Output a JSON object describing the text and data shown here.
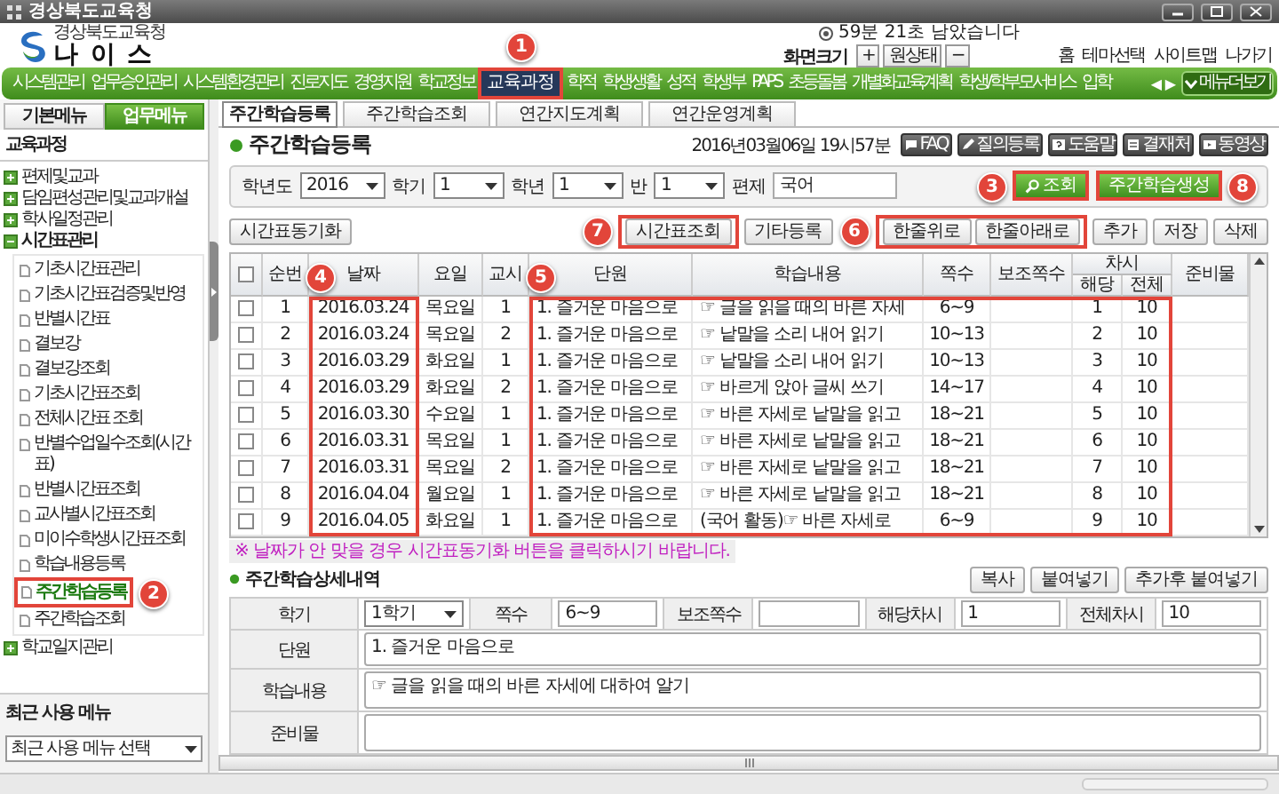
{
  "window": {
    "title": "경상북도교육청"
  },
  "header": {
    "org": "경상북도교육청",
    "logo": "나 이 스",
    "session": "59분 21초 남았습니다",
    "zoom_label": "화면크기",
    "zoom_buttons": [
      "+",
      "원상태",
      "−"
    ],
    "links": [
      "홈",
      "테마선택",
      "사이트맵",
      "나가기"
    ]
  },
  "nav": {
    "items": [
      {
        "label": "시스템관리",
        "selected": false,
        "framed": false
      },
      {
        "label": "업무승인관리",
        "selected": false,
        "framed": false
      },
      {
        "label": "시스템환경관리",
        "selected": false,
        "framed": false
      },
      {
        "label": "진로지도",
        "selected": false,
        "framed": false
      },
      {
        "label": "경영지원",
        "selected": false,
        "framed": false
      },
      {
        "label": "학교정보",
        "selected": false,
        "framed": false
      },
      {
        "label": "교육과정",
        "selected": true,
        "framed": true,
        "callout": "1"
      },
      {
        "label": "학적",
        "selected": false,
        "framed": false
      },
      {
        "label": "학생생활",
        "selected": false,
        "framed": false
      },
      {
        "label": "성적",
        "selected": false,
        "framed": false
      },
      {
        "label": "학생부",
        "selected": false,
        "framed": false
      },
      {
        "label": "PAPS",
        "selected": false,
        "framed": false
      },
      {
        "label": "초등돌봄",
        "selected": false,
        "framed": false
      },
      {
        "label": "개별화교육계획",
        "selected": false,
        "framed": false
      },
      {
        "label": "학생/학부모서비스",
        "selected": false,
        "framed": false
      },
      {
        "label": "입학",
        "selected": false,
        "framed": false
      }
    ],
    "prev": "◀",
    "next": "▶",
    "more": "메뉴더보기"
  },
  "sidebar": {
    "tabs": [
      {
        "label": "기본메뉴",
        "selected": false
      },
      {
        "label": "업무메뉴",
        "selected": true
      }
    ],
    "heading": "교육과정",
    "items": [
      {
        "label": "편제및교과",
        "expanded": false
      },
      {
        "label": "담임편성관리및교과개설",
        "expanded": false
      },
      {
        "label": "학사일정관리",
        "expanded": false
      },
      {
        "label": "시간표관리",
        "expanded": true,
        "children": [
          {
            "label": "기초시간표관리",
            "selected": false,
            "framed": false
          },
          {
            "label": "기초시간표검증및반영",
            "selected": false,
            "framed": false
          },
          {
            "label": "반별시간표",
            "selected": false,
            "framed": false
          },
          {
            "label": "결보강",
            "selected": false,
            "framed": false
          },
          {
            "label": "결보강조회",
            "selected": false,
            "framed": false
          },
          {
            "label": "기초시간표조회",
            "selected": false,
            "framed": false
          },
          {
            "label": "전체시간표 조회",
            "selected": false,
            "framed": false
          },
          {
            "label": "반별수업일수조회(시간표)",
            "selected": false,
            "framed": false
          },
          {
            "label": "반별시간표조회",
            "selected": false,
            "framed": false
          },
          {
            "label": "교사별시간표조회",
            "selected": false,
            "framed": false
          },
          {
            "label": "미이수학생시간표조회",
            "selected": false,
            "framed": false
          },
          {
            "label": "학습내용등록",
            "selected": false,
            "framed": false
          },
          {
            "label": "주간학습등록",
            "selected": true,
            "framed": true,
            "callout": "2"
          },
          {
            "label": "주간학습조회",
            "selected": false,
            "framed": false
          }
        ]
      },
      {
        "label": "학교일지관리",
        "expanded": false
      }
    ],
    "recent": {
      "title": "최근 사용 메뉴",
      "select": "최근 사용 메뉴 선택"
    }
  },
  "tabs": [
    {
      "label": "주간학습등록",
      "selected": true
    },
    {
      "label": "주간학습조회",
      "selected": false
    },
    {
      "label": "연간지도계획",
      "selected": false
    },
    {
      "label": "연간운영계획",
      "selected": false
    }
  ],
  "page": {
    "title": "주간학습등록",
    "datetime": "2016년03월06일 19시57분",
    "tools": [
      {
        "kind": "faq",
        "label": "FAQ"
      },
      {
        "kind": "write",
        "label": "질의등록"
      },
      {
        "kind": "help",
        "label": "도움말"
      },
      {
        "kind": "doc",
        "label": "결재처"
      },
      {
        "kind": "video",
        "label": "동영상"
      }
    ]
  },
  "filters": [
    {
      "label": "학년도",
      "kind": "select",
      "value": "2016"
    },
    {
      "label": "학기",
      "kind": "select",
      "value": "1"
    },
    {
      "label": "학년",
      "kind": "select",
      "value": "1"
    },
    {
      "label": "반",
      "kind": "select",
      "value": "1"
    },
    {
      "label": "편제",
      "kind": "text",
      "value": "국어"
    }
  ],
  "filter_buttons": [
    {
      "label": "조회",
      "kind": "search",
      "framed": true,
      "callout": "3"
    },
    {
      "label": "주간학습생성",
      "kind": "plain",
      "framed": true,
      "callout": "8"
    }
  ],
  "toolbar": {
    "left": [
      {
        "label": "시간표동기화",
        "framed": false
      }
    ],
    "right": [
      {
        "label": "시간표조회",
        "framed": true,
        "callout": "7"
      },
      {
        "label": "기타등록",
        "framed": false
      },
      {
        "label": "한줄위로",
        "framed": true,
        "callout": "6"
      },
      {
        "label": "한줄아래로",
        "framed": true
      },
      {
        "label": "추가",
        "framed": false
      },
      {
        "label": "저장",
        "framed": false
      },
      {
        "label": "삭제",
        "framed": false
      }
    ]
  },
  "table": {
    "columns": [
      {
        "kind": "check",
        "checked": false,
        "framed": false
      },
      {
        "label": "순번",
        "framed": false
      },
      {
        "label": "날짜",
        "framed": true,
        "callout": "4"
      },
      {
        "label": "요일",
        "framed": false
      },
      {
        "label": "교시",
        "framed": false
      },
      {
        "label": "단원",
        "framed": true,
        "callout": "5"
      },
      {
        "label": "학습내용",
        "framed": true
      },
      {
        "label": "쪽수",
        "framed": true
      },
      {
        "label": "보조쪽수",
        "framed": true
      },
      {
        "label": "차시",
        "framed": true,
        "subcolumns": [
          "해당",
          "전체"
        ]
      },
      {
        "label": "준비물",
        "framed": false
      }
    ],
    "rows": [
      {
        "checked": false,
        "no": "1",
        "date": "2016.03.24",
        "day": "목요일",
        "period": "1",
        "unit": "1. 즐거운 마음으로",
        "content": "☞ 글을 읽을 때의 바른 자세",
        "pages": "6~9",
        "part": "1",
        "total": "10"
      },
      {
        "checked": false,
        "no": "2",
        "date": "2016.03.24",
        "day": "목요일",
        "period": "2",
        "unit": "1. 즐거운 마음으로",
        "content": "☞ 낱말을 소리 내어 읽기",
        "pages": "10~13",
        "part": "2",
        "total": "10"
      },
      {
        "checked": false,
        "no": "3",
        "date": "2016.03.29",
        "day": "화요일",
        "period": "1",
        "unit": "1. 즐거운 마음으로",
        "content": "☞ 낱말을 소리 내어 읽기",
        "pages": "10~13",
        "part": "3",
        "total": "10"
      },
      {
        "checked": false,
        "no": "4",
        "date": "2016.03.29",
        "day": "화요일",
        "period": "2",
        "unit": "1. 즐거운 마음으로",
        "content": "☞ 바르게 앉아 글씨 쓰기",
        "pages": "14~17",
        "part": "4",
        "total": "10"
      },
      {
        "checked": false,
        "no": "5",
        "date": "2016.03.30",
        "day": "수요일",
        "period": "1",
        "unit": "1. 즐거운 마음으로",
        "content": "☞ 바른 자세로 낱말을 읽고",
        "pages": "18~21",
        "part": "5",
        "total": "10"
      },
      {
        "checked": false,
        "no": "6",
        "date": "2016.03.31",
        "day": "목요일",
        "period": "1",
        "unit": "1. 즐거운 마음으로",
        "content": "☞ 바른 자세로 낱말을 읽고",
        "pages": "18~21",
        "part": "6",
        "total": "10"
      },
      {
        "checked": false,
        "no": "7",
        "date": "2016.03.31",
        "day": "목요일",
        "period": "2",
        "unit": "1. 즐거운 마음으로",
        "content": "☞ 바른 자세로 낱말을 읽고",
        "pages": "18~21",
        "part": "7",
        "total": "10"
      },
      {
        "checked": false,
        "no": "8",
        "date": "2016.04.04",
        "day": "월요일",
        "period": "1",
        "unit": "1. 즐거운 마음으로",
        "content": "☞ 바른 자세로 낱말을 읽고",
        "pages": "18~21",
        "part": "8",
        "total": "10"
      },
      {
        "checked": false,
        "no": "9",
        "date": "2016.04.05",
        "day": "화요일",
        "period": "1",
        "unit": "1. 즐거운 마음으로",
        "content": "(국어 활동)☞ 바른 자세로",
        "pages": "6~9",
        "part": "9",
        "total": "10"
      }
    ]
  },
  "note": "※ 날짜가 안 맞을 경우 시간표동기화 버튼을 클릭하시기 바랍니다.",
  "detail": {
    "title": "주간학습상세내역",
    "buttons": [
      "복사",
      "붙여넣기",
      "추가후 붙여넣기"
    ],
    "fields": [
      {
        "label": "학기",
        "kind": "select",
        "value": "1학기"
      },
      {
        "label": "쪽수",
        "kind": "text",
        "value": "6~9"
      },
      {
        "label": "보조쪽수",
        "kind": "text"
      },
      {
        "label": "해당차시",
        "kind": "text",
        "value": "1"
      },
      {
        "label": "전체차시",
        "kind": "text",
        "value": "10"
      },
      {
        "label": "단원",
        "kind": "area",
        "value": "1. 즐거운 마음으로"
      },
      {
        "label": "학습내용",
        "kind": "area",
        "value": "☞ 글을 읽을 때의 바른 자세에 대하여 알기"
      },
      {
        "label": "준비물",
        "kind": "area"
      }
    ]
  }
}
